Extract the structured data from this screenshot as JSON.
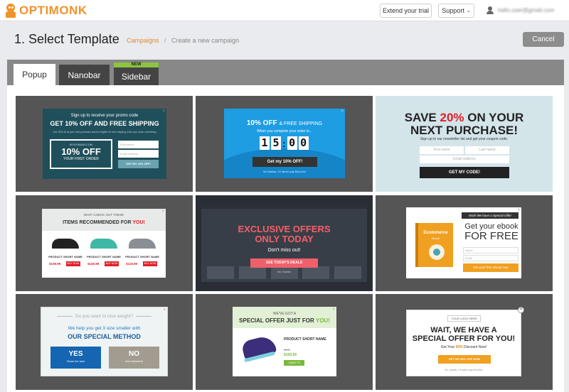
{
  "header": {
    "logo_text": "OPTIMONK",
    "extend_trial_label": "Extend your trial",
    "support_label": "Support",
    "user_email": "hello.user@gmail.com"
  },
  "page": {
    "title": "1. Select Template",
    "breadcrumb_link": "Campaigns",
    "breadcrumb_separator": "/",
    "breadcrumb_current": "Create a new campaign",
    "cancel_label": "Cancel"
  },
  "tabs": [
    {
      "label": "Popup",
      "active": true
    },
    {
      "label": "Nanobar",
      "active": false
    },
    {
      "label": "Sidebar",
      "active": false,
      "badge": "NEW"
    }
  ],
  "templates": {
    "t1": {
      "headline_small": "Sign up to receive your promo code",
      "headline": "GET 10% OFF AND FREE SHIPPING",
      "subtext": "Get 10% off at your next purchase and be eligible for free shipping when you order something",
      "box_top": "MYDOMAIN.COM",
      "box_big": "10% OFF",
      "box_bottom": "YOUR FIRST ORDER",
      "input1": "First name",
      "input2": "Email address",
      "button": "GET MY 10% OFF!"
    },
    "t2": {
      "headline_bold": "10% OFF",
      "headline_rest": "& FREE SHIPPING",
      "subtext": "When you complete your order in...",
      "digits": [
        "1",
        "5",
        "0",
        "0"
      ],
      "colon": ":",
      "button": "Get my 10% OFF!",
      "no_thanks": "No thanks, I'd rather pay full price"
    },
    "t3": {
      "line1_pre": "SAVE ",
      "line1_highlight": "20%",
      "line1_post": " ON YOUR",
      "line2": "NEXT PURCHASE!",
      "subtext": "Sign up to our newsletter list and get your coupon code.",
      "input1": "First name",
      "input2": "Last name",
      "input3": "Email address",
      "button": "GET MY CODE!"
    },
    "t4": {
      "pretitle": "WAIT! CHECK OUT THESE",
      "title_pre": "ITEMS RECOMMENDED FOR ",
      "title_highlight": "YOU!",
      "products": [
        {
          "name": "PRODUCT SHORT NAME",
          "price": "$109.99",
          "button": "BUY NOW",
          "color": "#222222"
        },
        {
          "name": "PRODUCT SHORT NAME",
          "price": "$149.99",
          "button": "BUY NOW",
          "color": "#3fb8a6"
        },
        {
          "name": "PRODUCT SHORT NAME",
          "price": "$119.99",
          "button": "BUY NOW",
          "color": "#8a8f96"
        }
      ]
    },
    "t5": {
      "line1": "EXCLUSIVE OFFERS",
      "line2": "ONLY TODAY",
      "subtext": "Don't miss out!",
      "button": "SEE TODAY'S DEALS",
      "no_thanks": "No, thanks"
    },
    "t6": {
      "ribbon": "Wait! We have a Special Offer",
      "book_title": "Ecommerce",
      "book_sub": "eBook",
      "line1": "Get your ebook",
      "line2": "FOR FREE",
      "input1": "Name",
      "input2": "Email",
      "button": "Get your free ebook now"
    },
    "t7": {
      "question": "Do you want to lose weight?",
      "subtext": "We help you get 3 size smaller with",
      "method": "OUR SPECIAL METHOD",
      "yes_label": "YES",
      "yes_sub": "Show me how",
      "no_label": "NO",
      "no_sub": "Not interested"
    },
    "t8": {
      "pretitle": "WE'VE GOT A",
      "title_pre": "SPECIAL OFFER JUST FOR ",
      "title_highlight": "YOU!",
      "product_name": "PRODUCT SHORT NAME",
      "old_price": "$149",
      "price": "$109.99",
      "button": "I WANT IT!"
    },
    "t9": {
      "logo_label": "YOUR LOGO HERE",
      "line1": "WAIT, WE HAVE A",
      "line2": "SPECIAL OFFER FOR YOU!",
      "sub_pre": "Get Your ",
      "sub_highlight": "50%",
      "sub_post": " Discount Now!",
      "button": "GET MY 50% OFF NOW",
      "no_thanks": "No, thanks, I'd rather pay full price"
    }
  }
}
